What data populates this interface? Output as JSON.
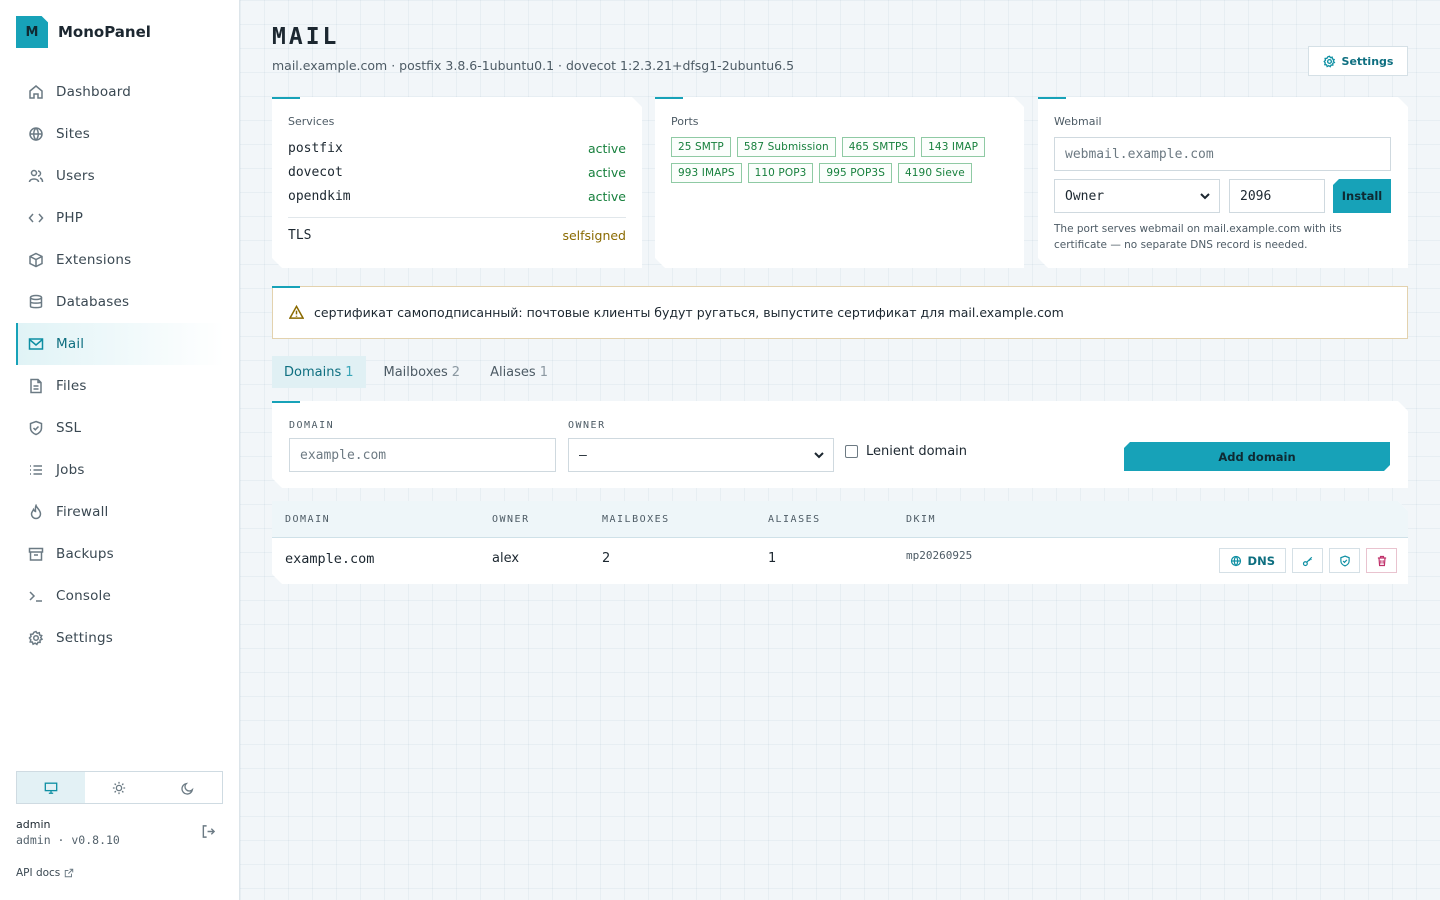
{
  "app": {
    "logo_letter": "M",
    "name": "MonoPanel"
  },
  "sidebar": {
    "items": [
      {
        "label": "Dashboard",
        "icon": "home-icon"
      },
      {
        "label": "Sites",
        "icon": "globe-icon"
      },
      {
        "label": "Users",
        "icon": "users-icon"
      },
      {
        "label": "PHP",
        "icon": "code-icon"
      },
      {
        "label": "Extensions",
        "icon": "cube-icon"
      },
      {
        "label": "Databases",
        "icon": "database-icon"
      },
      {
        "label": "Mail",
        "icon": "mail-icon",
        "active": true
      },
      {
        "label": "Files",
        "icon": "file-icon"
      },
      {
        "label": "SSL",
        "icon": "shield-icon"
      },
      {
        "label": "Jobs",
        "icon": "list-icon"
      },
      {
        "label": "Firewall",
        "icon": "flame-icon"
      },
      {
        "label": "Backups",
        "icon": "archive-icon"
      },
      {
        "label": "Console",
        "icon": "terminal-icon"
      },
      {
        "label": "Settings",
        "icon": "gear-icon"
      }
    ],
    "theme_modes": [
      "system",
      "light",
      "dark"
    ],
    "active_theme": "system",
    "user": {
      "name": "admin",
      "meta": "admin · v0.8.10"
    },
    "api_docs": "API docs"
  },
  "header": {
    "title": "MAIL",
    "subtitle": "mail.example.com · postfix 3.8.6-1ubuntu0.1 · dovecot 1:2.3.21+dfsg1-2ubuntu6.5",
    "settings_label": "Settings"
  },
  "services": {
    "label": "Services",
    "items": [
      {
        "name": "postfix",
        "status": "active"
      },
      {
        "name": "dovecot",
        "status": "active"
      },
      {
        "name": "opendkim",
        "status": "active"
      }
    ],
    "tls": {
      "name": "TLS",
      "status": "selfsigned"
    }
  },
  "ports": {
    "label": "Ports",
    "items": [
      "25 SMTP",
      "587 Submission",
      "465 SMTPS",
      "143 IMAP",
      "993 IMAPS",
      "110 POP3",
      "995 POP3S",
      "4190 Sieve"
    ]
  },
  "webmail": {
    "label": "Webmail",
    "host_placeholder": "webmail.example.com",
    "owner_value": "Owner",
    "port_value": "2096",
    "install_label": "Install",
    "note": "The port serves webmail on mail.example.com with its certificate — no separate DNS record is needed."
  },
  "alert": {
    "text": "сертификат самоподписанный: почтовые клиенты будут ругаться, выпустите сертификат для mail.example.com"
  },
  "tabs": [
    {
      "label": "Domains",
      "count": "1",
      "active": true
    },
    {
      "label": "Mailboxes",
      "count": "2"
    },
    {
      "label": "Aliases",
      "count": "1"
    }
  ],
  "add_form": {
    "domain_label": "DOMAIN",
    "domain_placeholder": "example.com",
    "owner_label": "OWNER",
    "owner_value": "–",
    "lenient_label": "Lenient domain",
    "add_label": "Add domain"
  },
  "table": {
    "headers": [
      "DOMAIN",
      "OWNER",
      "MAILBOXES",
      "ALIASES",
      "DKIM"
    ],
    "rows": [
      {
        "domain": "example.com",
        "owner": "alex",
        "mailboxes": "2",
        "aliases": "1",
        "dkim": "mp20260925",
        "dns_label": "DNS"
      }
    ]
  }
}
